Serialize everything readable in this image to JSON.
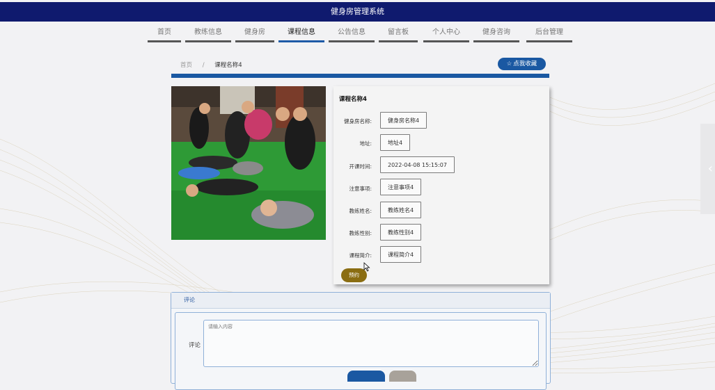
{
  "app": {
    "title": "健身房管理系统"
  },
  "nav": {
    "items": [
      {
        "label": "首页"
      },
      {
        "label": "教练信息"
      },
      {
        "label": "健身房"
      },
      {
        "label": "课程信息"
      },
      {
        "label": "公告信息"
      },
      {
        "label": "留言板"
      },
      {
        "label": "个人中心"
      },
      {
        "label": "健身咨询"
      },
      {
        "label": "后台管理"
      }
    ],
    "active_index": 3
  },
  "breadcrumb": {
    "home": "首页",
    "separator": "/",
    "current": "课程名称4"
  },
  "favorite_button": {
    "label": "点我收藏",
    "icon": "star-icon"
  },
  "course": {
    "title": "课程名称4",
    "fields": [
      {
        "label": "健身房名称:",
        "value": "健身房名称4"
      },
      {
        "label": "地址:",
        "value": "地址4"
      },
      {
        "label": "开课时间:",
        "value": "2022-04-08 15:15:07"
      },
      {
        "label": "注意事项:",
        "value": "注意事项4"
      },
      {
        "label": "教练姓名:",
        "value": "教练姓名4"
      },
      {
        "label": "教练性别:",
        "value": "教练性别4"
      },
      {
        "label": "课程简介:",
        "value": "课程简介4"
      }
    ],
    "book_label": "预约"
  },
  "comments": {
    "header": "评论",
    "field_label": "评论",
    "placeholder": "请输入内容"
  },
  "colors": {
    "topbar": "#0f1a6e",
    "accent": "#1a58a2",
    "book_button": "#8a6d12"
  }
}
